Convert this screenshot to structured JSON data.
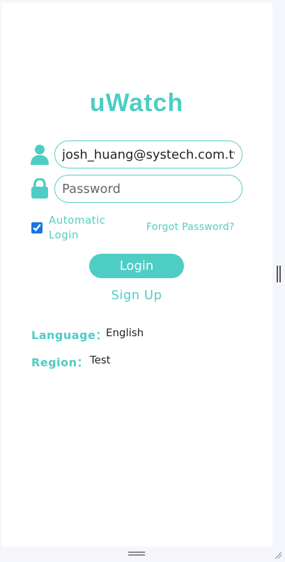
{
  "app": {
    "title": "uWatch"
  },
  "login_form": {
    "email_value": "josh_huang@systech.com.tw",
    "password_placeholder": "Password",
    "automatic_login_label": "Automatic Login",
    "automatic_login_checked": true,
    "forgot_password_label": "Forgot Password?",
    "login_button_label": "Login",
    "sign_up_label": "Sign Up"
  },
  "settings": {
    "language_label": "Language：",
    "language_value": "English",
    "region_label": "Region：",
    "region_value": "Test"
  },
  "colors": {
    "accent": "#4ecdc4",
    "checkbox": "#1a73e8",
    "background": "#f4f6fb"
  },
  "icons": [
    "user-icon",
    "lock-icon"
  ]
}
